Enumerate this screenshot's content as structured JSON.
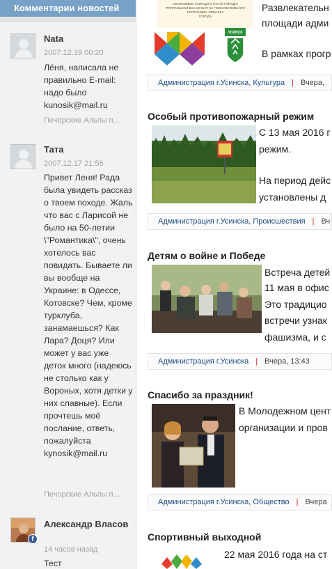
{
  "sidebar": {
    "title": "Комментарии новостей",
    "comments": [
      {
        "name": "Nata",
        "date": "2007.12.19 00:20",
        "text": "Лёня, написала не правильно E-mail: надо было kunosik@mail.ru",
        "source": "Печорские Альпы п..."
      },
      {
        "name": "Тата",
        "date": "2007.12.17 21:56",
        "text": "Привет Леня! Рада была увидеть рассказ о твоем походе. Жаль что вас с Ларисой не было на 50-летии \\\"Романтика\\\", очень хотелось вас повидать. Бываете ли вы вообще на Украине: в Одессе, Котовске? Чем, кроме турклуба, занамаешься? Как Лара? Доця? Или может у вас уже деток много (надеюсь не столько как у Вороных, хотя детки у них славные). Если прочтешь моё послание, ответь, пожалуйста kynosik@mail.ru",
        "source": "Печорские Альпы п..."
      },
      {
        "name": "Александр Власов",
        "date": "14 часов назад",
        "text": "Тест",
        "badge": "f"
      }
    ]
  },
  "articles": [
    {
      "title": "",
      "lines": [
        "Развлекательн",
        "площади адми",
        "",
        "В рамках прогр"
      ],
      "poster_lines": [
        "УВАЖАЕМЫЕ УСИНЦЫ И ГОСТИ ГОРОДА!",
        "ПРИГЛАШАЕМ ВАС 22 МАЯ НА ПОЗНАВАТЕЛЬНУЮ",
        "ПРОГРАММУ, ЯРМАРКУ",
        "ГОРОДА",
        "УСИНСК"
      ],
      "meta_source": "Администрация г.Усинска, Культура",
      "meta_date": "Вчера,"
    },
    {
      "title": "Особый противопожарный режим",
      "lines": [
        "С 13 мая 2016 г",
        "режим.",
        "",
        "На период дейс",
        "установлены д"
      ],
      "meta_source": "Администрация г.Усинска, Происшествия",
      "meta_date": "Вч"
    },
    {
      "title": "Детям о войне и Победе",
      "lines": [
        "Встреча детей",
        "11 мая в офис",
        "Это традицио",
        "встречи узнак",
        "фашизма, и с"
      ],
      "meta_source": "Администрация г.Усинска",
      "meta_date": "Вчера, 13:43"
    },
    {
      "title": "Спасибо за праздник!",
      "lines": [
        "В Молодежном цент",
        "организации и пров"
      ],
      "meta_source": "Администрация г.Усинска, Общество",
      "meta_date": "Вчера"
    },
    {
      "title": "Спортивный выходной",
      "lines": [
        "22 мая 2016 года на ст"
      ],
      "meta_source": "",
      "meta_date": ""
    }
  ],
  "icons": {
    "default_avatar": "person-silhouette-icon",
    "facebook": "facebook-icon"
  },
  "colors": {
    "sidebar_header": "#78a1c8",
    "meta_link": "#1f4e86",
    "meta_separator": "#c7332d",
    "facebook": "#3b5998"
  }
}
